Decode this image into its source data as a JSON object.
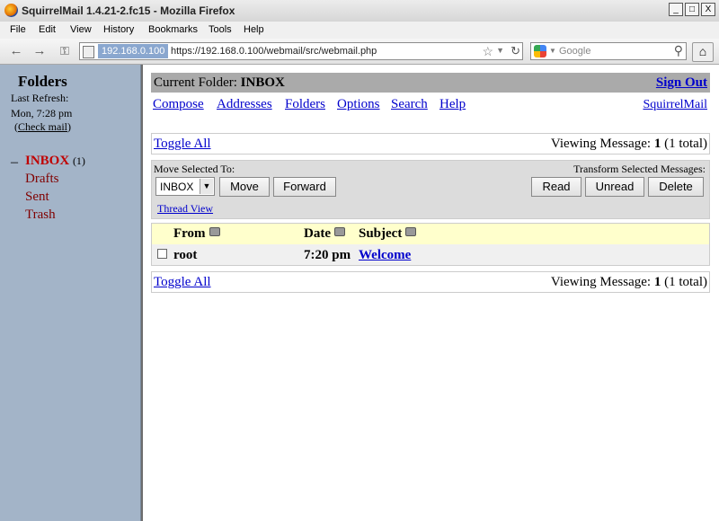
{
  "window": {
    "title": "SquirrelMail 1.4.21-2.fc15 - Mozilla Firefox",
    "buttons": [
      "_",
      "□",
      "X"
    ]
  },
  "menu": [
    "File",
    "Edit",
    "View",
    "History",
    "Bookmarks",
    "Tools",
    "Help"
  ],
  "nav": {
    "ip_badge": "192.168.0.100",
    "url": "https://192.168.0.100/webmail/src/webmail.php",
    "search_placeholder": "Google"
  },
  "sidebar": {
    "title": "Folders",
    "last_refresh_label": "Last Refresh:",
    "last_refresh_time": "Mon, 7:28 pm",
    "check_mail": "Check mail",
    "collapse_marker": "–",
    "inbox_label": "INBOX",
    "inbox_count": "(1)",
    "folders": [
      "Drafts",
      "Sent",
      "Trash"
    ]
  },
  "main": {
    "current_folder_label": "Current Folder:",
    "current_folder": "INBOX",
    "sign_out": "Sign Out",
    "links": [
      "Compose",
      "Addresses",
      "Folders",
      "Options",
      "Search",
      "Help"
    ],
    "brand_link": "SquirrelMail",
    "toggle_all": "Toggle All",
    "viewing_prefix": "Viewing Message:",
    "viewing_number": "1",
    "viewing_suffix": "(1 total)",
    "move_selected_label": "Move Selected To:",
    "transform_label": "Transform Selected Messages:",
    "move_folder_selected": "INBOX",
    "move_button": "Move",
    "forward_button": "Forward",
    "read_button": "Read",
    "unread_button": "Unread",
    "delete_button": "Delete",
    "thread_view": "Thread View",
    "columns": {
      "from": "From",
      "date": "Date",
      "subject": "Subject"
    },
    "messages": [
      {
        "from": "root",
        "date": "7:20 pm",
        "subject": "Welcome"
      }
    ]
  }
}
